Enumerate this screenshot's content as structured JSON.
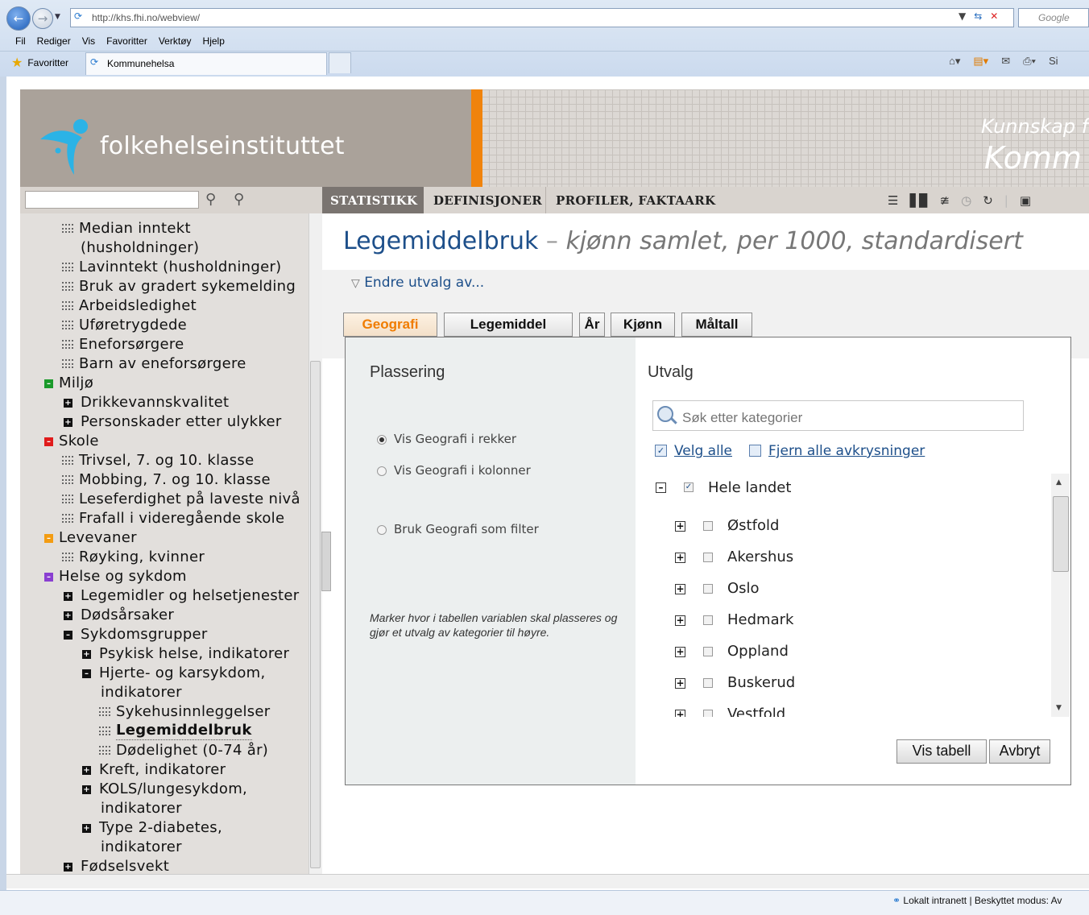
{
  "browser": {
    "url": "http://khs.fhi.no/webview/",
    "search_engine": "Google",
    "menu": [
      "Fil",
      "Rediger",
      "Vis",
      "Favoritter",
      "Verktøy",
      "Hjelp"
    ],
    "favorites_label": "Favoritter",
    "tab_title": "Kommunehelsa",
    "status": "Lokalt intranett | Beskyttet modus: Av"
  },
  "banner": {
    "logo_text": "folkehelseinstituttet",
    "tagline1": "Kunnskap f",
    "tagline2": "Komm"
  },
  "nav": {
    "tabs": [
      "STATISTIKK",
      "DEFINISJONER",
      "PROFILER, FAKTAARK"
    ]
  },
  "sidebar": {
    "items": [
      {
        "label": "Median inntekt",
        "type": "doc"
      },
      {
        "label": "(husholdninger)",
        "type": "cont"
      },
      {
        "label": "Lavinntekt (husholdninger)",
        "type": "doc"
      },
      {
        "label": "Bruk av gradert sykemelding",
        "type": "doc"
      },
      {
        "label": "Arbeidsledighet",
        "type": "doc"
      },
      {
        "label": "Uføretrygdede",
        "type": "doc"
      },
      {
        "label": "Eneforsørgere",
        "type": "doc"
      },
      {
        "label": "Barn av eneforsørgere",
        "type": "doc"
      },
      {
        "label": "Miljø",
        "type": "cat"
      },
      {
        "label": "Drikkevannskvalitet",
        "type": "plus"
      },
      {
        "label": "Personskader etter ulykker",
        "type": "plus"
      },
      {
        "label": "Skole",
        "type": "cat"
      },
      {
        "label": "Trivsel, 7. og 10. klasse",
        "type": "doc"
      },
      {
        "label": "Mobbing, 7. og 10. klasse",
        "type": "doc"
      },
      {
        "label": "Leseferdighet på laveste nivå",
        "type": "doc"
      },
      {
        "label": "Frafall i videregående skole",
        "type": "doc"
      },
      {
        "label": "Levevaner",
        "type": "cat"
      },
      {
        "label": "Røyking, kvinner",
        "type": "doc"
      },
      {
        "label": "Helse og sykdom",
        "type": "cat"
      },
      {
        "label": "Legemidler og helsetjenester",
        "type": "plus"
      },
      {
        "label": "Dødsårsaker",
        "type": "plus"
      },
      {
        "label": "Sykdomsgrupper",
        "type": "minus"
      },
      {
        "label": "Psykisk helse, indikatorer",
        "type": "plus"
      },
      {
        "label": "Hjerte- og karsykdom,",
        "type": "minus"
      },
      {
        "label": "indikatorer",
        "type": "cont"
      },
      {
        "label": "Sykehusinnleggelser",
        "type": "doc"
      },
      {
        "label": "Legemiddelbruk",
        "type": "doc"
      },
      {
        "label": "Dødelighet (0-74 år)",
        "type": "doc"
      },
      {
        "label": "Kreft, indikatorer",
        "type": "plus"
      },
      {
        "label": "KOLS/lungesykdom,",
        "type": "plus"
      },
      {
        "label": "indikatorer",
        "type": "cont"
      },
      {
        "label": "Type 2-diabetes,",
        "type": "plus"
      },
      {
        "label": "indikatorer",
        "type": "cont"
      },
      {
        "label": "Fødselsvekt",
        "type": "plus"
      }
    ],
    "category_colors": {
      "Miljø": "#1a9a2a",
      "Skole": "#e01b1b",
      "Levevaner": "#f39c12",
      "Helse og sykdom": "#8a3fd1"
    }
  },
  "main": {
    "title": "Legemiddelbruk",
    "title_dash": "–",
    "subtitle": "kjønn samlet, per 1000, standardisert",
    "endre": "Endre utvalg av...",
    "tabs": [
      "Geografi",
      "Legemiddel",
      "År",
      "Kjønn",
      "Måltall"
    ],
    "left": {
      "heading": "Plassering",
      "options": [
        "Vis Geografi i rekker",
        "Vis Geografi i kolonner",
        "Bruk Geografi som filter"
      ],
      "selected": "Vis Geografi i rekker",
      "hint": "Marker hvor i tabellen variablen skal plasseres og gjør et utvalg av kategorier til høyre."
    },
    "right": {
      "heading": "Utvalg",
      "search_placeholder": "Søk etter kategorier",
      "velg_alle": "Velg alle",
      "fjern_alle": "Fjern alle avkrysninger",
      "root": "Hele landet",
      "counties": [
        "Østfold",
        "Akershus",
        "Oslo",
        "Hedmark",
        "Oppland",
        "Buskerud",
        "Vestfold"
      ]
    },
    "buttons": {
      "show": "Vis tabell",
      "cancel": "Avbryt"
    }
  }
}
